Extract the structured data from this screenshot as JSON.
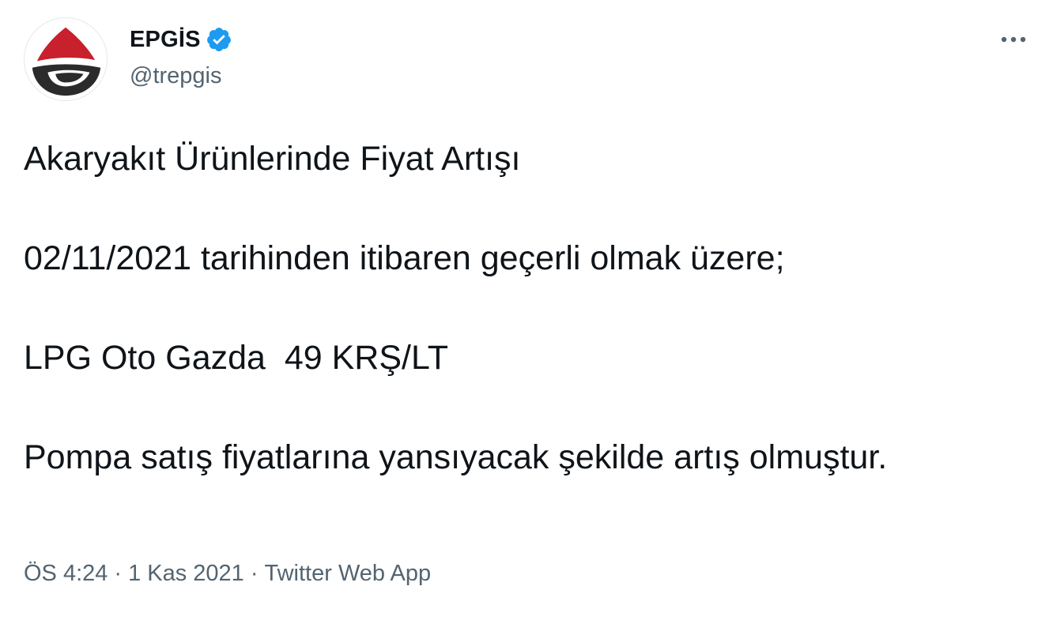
{
  "author": {
    "display_name": "EPGİS",
    "handle": "@trepgis",
    "verified": true,
    "avatar_icon": "epgis-logo-icon"
  },
  "menu": {
    "icon": "more-horizontal-icon"
  },
  "tweet": {
    "lines": [
      "Akaryakıt Ürünlerinde Fiyat Artışı",
      "02/11/2021 tarihinden itibaren geçerli olmak üzere;",
      "LPG Oto Gazda  49 KRŞ/LT",
      "Pompa satış fiyatlarına yansıyacak şekilde artış olmuştur."
    ]
  },
  "meta": {
    "time": "ÖS 4:24",
    "separator": "·",
    "date": "1 Kas 2021",
    "source": "Twitter Web App"
  },
  "colors": {
    "text_primary": "#0f1419",
    "text_secondary": "#536471",
    "verified_blue": "#1d9bf0",
    "logo_red": "#c8202c",
    "logo_dark": "#2b2b2b"
  }
}
